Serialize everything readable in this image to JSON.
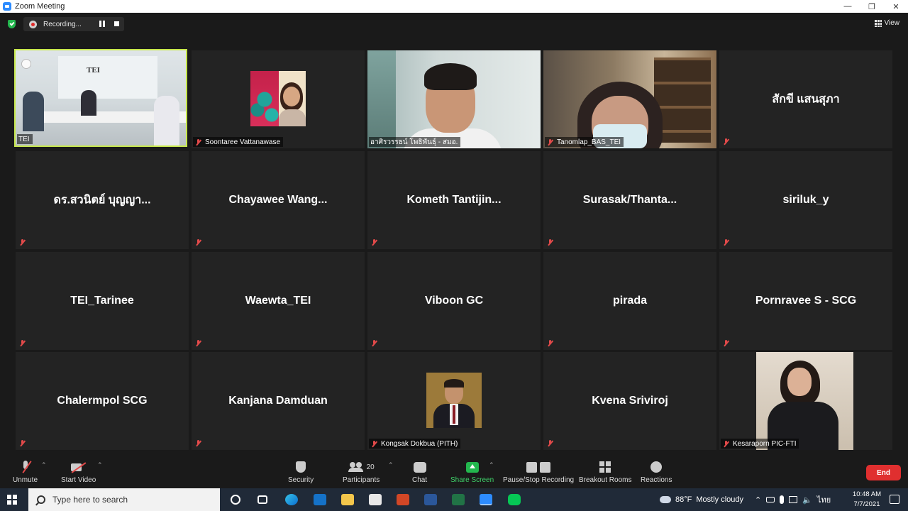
{
  "window": {
    "title": "Zoom Meeting"
  },
  "meeting": {
    "recording_label": "Recording...",
    "view_label": "View"
  },
  "tiles": [
    {
      "name": "TEI"
    },
    {
      "name": "Soontaree Vattanawase"
    },
    {
      "name": "อาศิรวรรธน์ โพธิพันธุ์ - สมอ."
    },
    {
      "name": "Tanomlap_BAS_TEI"
    },
    {
      "name": "สักขี แสนสุภา"
    },
    {
      "name": "ดร.สวนิตย์ บุญญา..."
    },
    {
      "name": "Chayawee  Wang..."
    },
    {
      "name": "Kometh  Tantijin..."
    },
    {
      "name": "Surasak/Thanta..."
    },
    {
      "name": "siriluk_y"
    },
    {
      "name": "TEI_Tarinee"
    },
    {
      "name": "Waewta_TEI"
    },
    {
      "name": "Viboon GC"
    },
    {
      "name": "pirada"
    },
    {
      "name": "Pornravee S - SCG"
    },
    {
      "name": "Chalermpol SCG"
    },
    {
      "name": "Kanjana Damduan"
    },
    {
      "name": "Kongsak Dokbua (PITH)"
    },
    {
      "name": "Kvena Sriviroj"
    },
    {
      "name": "Kesaraporn PIC-FTI"
    }
  ],
  "office_logo": "TEI",
  "toolbar": {
    "unmute": "Unmute",
    "start_video": "Start Video",
    "security": "Security",
    "participants": "Participants",
    "participants_count": "20",
    "chat": "Chat",
    "share_screen": "Share Screen",
    "pause_stop_recording": "Pause/Stop Recording",
    "breakout_rooms": "Breakout Rooms",
    "reactions": "Reactions",
    "end": "End"
  },
  "taskbar": {
    "search_placeholder": "Type here to search",
    "weather_temp": "88°F",
    "weather_text": "Mostly cloudy",
    "language": "ไทย",
    "time": "10:48 AM",
    "date": "7/7/2021"
  },
  "colors": {
    "active_speaker_border": "#c7e84c",
    "end_button": "#e02f2f",
    "share_screen": "#23b74e",
    "mic_muted": "#e34a4a"
  }
}
